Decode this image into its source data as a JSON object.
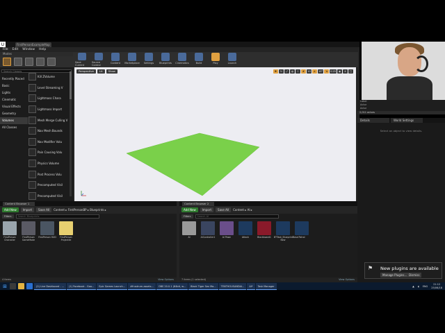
{
  "window": {
    "title": "Unreal Editor"
  },
  "tab": {
    "label": "FirstPersonExampleMap"
  },
  "menu": [
    "File",
    "Edit",
    "Window",
    "Help"
  ],
  "modes": {
    "title": "Modes",
    "search_placeholder": "Search Classes",
    "categories": [
      "Recently Placed",
      "Basic",
      "Lights",
      "Cinematic",
      "Visual Effects",
      "Geometry",
      "Volumes",
      "All Classes"
    ],
    "selected_category": "Volumes",
    "items": [
      "Kill ZVolume",
      "Level Streaming V",
      "Lightmass Chara",
      "Lightmass Import",
      "Mesh Merge Culling V",
      "Nav Mesh Bounds",
      "Nav Modifier Volu",
      "Pain Causing Volu",
      "Physics Volume",
      "Post Process Volu",
      "Precomputed Visil",
      "Precomputed Visil"
    ]
  },
  "toolbar": [
    "Save Current",
    "Source Control",
    "Content",
    "Marketplace",
    "Settings",
    "Blueprints",
    "Cinematics",
    "Build",
    "Play",
    "Launch"
  ],
  "viewport": {
    "buttons": [
      "Perspective",
      "Lit",
      "Show"
    ],
    "grid_value": "10",
    "angle_value": "10°",
    "scale_value": "0.25",
    "cam_value": "4"
  },
  "world": {
    "rows": [
      "Label",
      "Actor",
      "Actor"
    ],
    "count": "2,011 actors",
    "view_options": "View Options"
  },
  "details": {
    "tabs": [
      "Details",
      "World Settings"
    ],
    "message": "Select an object to view details."
  },
  "cb1": {
    "tab": "Content Browser 1",
    "add_new": "Add New",
    "import": "Import",
    "save_all": "Save All",
    "path": [
      "Content",
      "FirstPersonBP",
      "Blueprints"
    ],
    "filters": "Filters",
    "search_placeholder": "Search Blueprints",
    "assets": [
      {
        "label": "FirstPerson Character",
        "color": "#9aa5ad"
      },
      {
        "label": "FirstPerson GameMode",
        "color": "#5a5a64"
      },
      {
        "label": "FirstPerson HUD",
        "color": "#4a5562"
      },
      {
        "label": "FirstPerson Projectile",
        "color": "#e8d070"
      }
    ],
    "count": "4 items",
    "view_options": "View Options"
  },
  "cb2": {
    "tab": "Content Browser 2",
    "add_new": "Add New",
    "import": "Import",
    "save_all": "Save All",
    "path": [
      "Content",
      "AI"
    ],
    "filters": "Filters",
    "search_placeholder": "Search AI",
    "assets": [
      {
        "label": "AI",
        "color": "#9a9a9a"
      },
      {
        "label": "AIController1",
        "color": "#3a4560"
      },
      {
        "label": "AI Pawn",
        "color": "#6a4e8a"
      },
      {
        "label": "Attack",
        "color": "#1d3a5e"
      },
      {
        "label": "Blackboard1",
        "color": "#8a1a2a"
      },
      {
        "label": "BTTask_BlueprintBase New",
        "color": "#1d3a5e"
      },
      {
        "label": "Patrol",
        "color": "#1d3a5e"
      }
    ],
    "count": "7 items (1 selected)",
    "view_options": "View Options"
  },
  "notification": {
    "title": "New plugins are available",
    "manage": "Manage Plugins...",
    "dismiss": "Dismiss"
  },
  "taskbar": {
    "tasks": [
      "(2) Live Dashboard - ...",
      "(1) Facebook - Goo...",
      "Epic Games Launch...",
      "#frustrum-assets...",
      "OBS 20.0.1 (64bit, w...",
      "Black Tiger Sex Ma...",
      "TENTHOUSANDAI...",
      "AI*",
      "Task Manager"
    ],
    "lang": "ENG",
    "time": "21:12",
    "date": "25/06/18"
  }
}
